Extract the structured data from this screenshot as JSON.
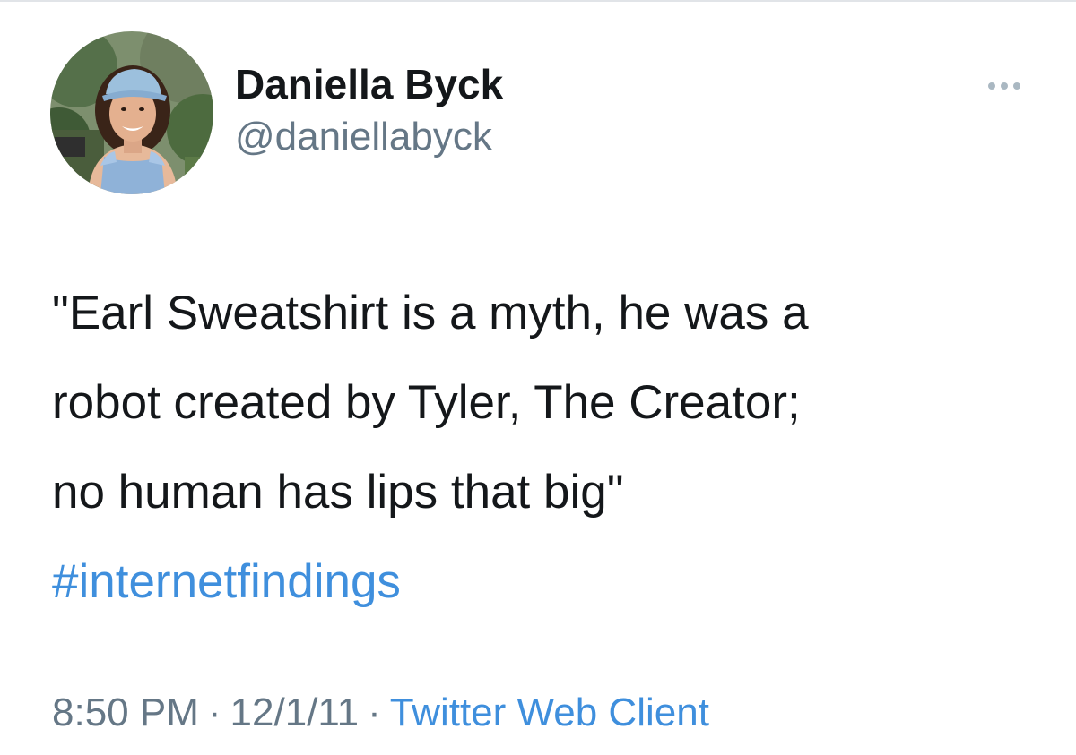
{
  "user": {
    "display_name": "Daniella Byck",
    "handle": "@daniellabyck",
    "avatar_icon": "profile-photo"
  },
  "more_icon": "ellipsis-icon",
  "tweet": {
    "lines": [
      "\"Earl Sweatshirt is a myth, he was a",
      "robot created by Tyler, The Creator;",
      "no human has lips that big\""
    ],
    "hashtag": "#internetfindings"
  },
  "meta": {
    "time": "8:50 PM",
    "separator": "·",
    "date": "12/1/11",
    "source": "Twitter Web Client"
  },
  "colors": {
    "text": "#14171a",
    "secondary": "#657786",
    "link": "#3f8fdd",
    "divider": "#e1e4e8"
  }
}
